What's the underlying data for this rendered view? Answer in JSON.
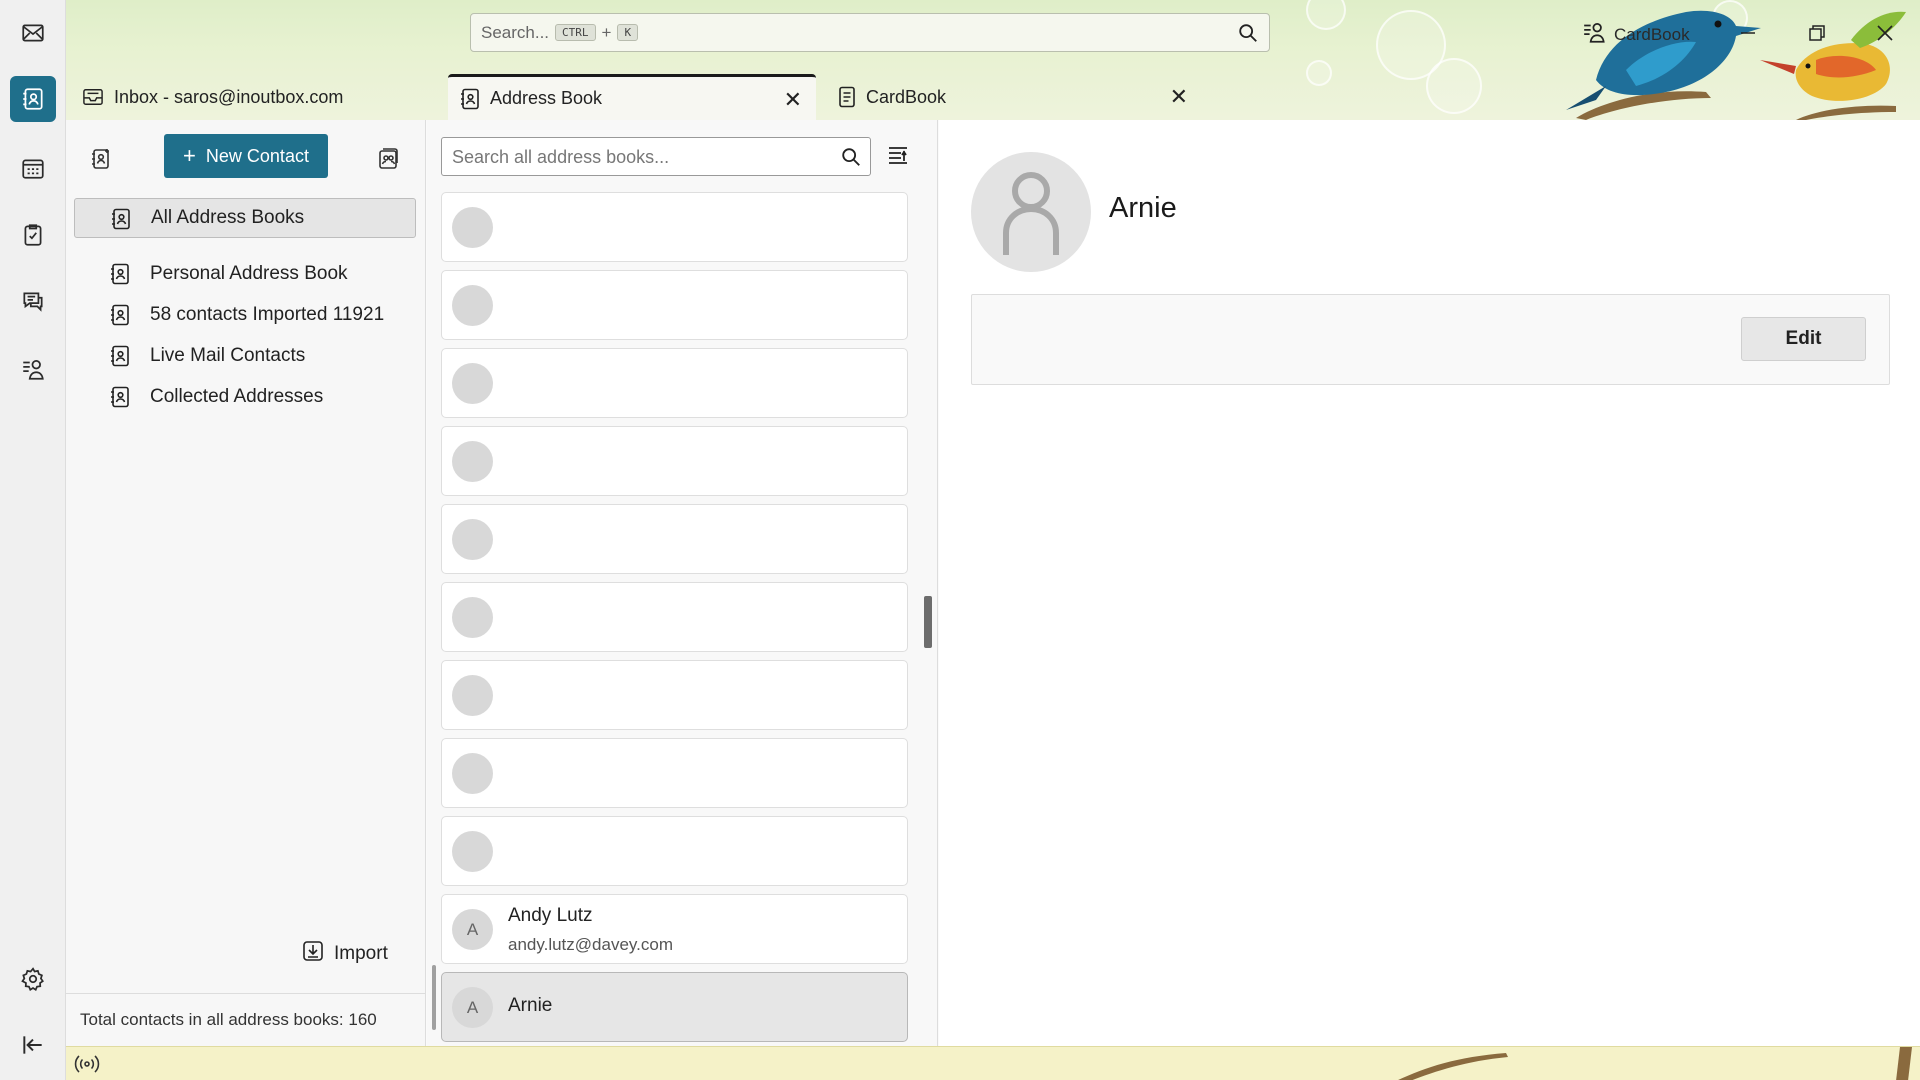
{
  "spaces": {
    "items": [
      {
        "name": "mail-icon"
      },
      {
        "name": "address-book-icon",
        "active": true
      },
      {
        "name": "calendar-icon"
      },
      {
        "name": "tasks-icon"
      },
      {
        "name": "chat-icon"
      },
      {
        "name": "cardbook-icon"
      }
    ],
    "bottom": [
      {
        "name": "settings-icon"
      },
      {
        "name": "collapse-icon"
      }
    ]
  },
  "titlebar": {
    "search_placeholder": "Search...",
    "shortcut_ctrl": "CTRL",
    "shortcut_plus": "+",
    "shortcut_key": "K",
    "cardbook_label": "CardBook"
  },
  "tabs": [
    {
      "label": "Inbox - saros@inoutbox.com",
      "icon": "inbox-icon"
    },
    {
      "label": "Address Book",
      "icon": "address-book-icon",
      "active": true,
      "close": "✕"
    },
    {
      "label": "CardBook",
      "icon": "cardbook-tab-icon",
      "close": "✕"
    }
  ],
  "left": {
    "new_contact": "New Contact",
    "new_contact_plus": "+",
    "books": [
      {
        "label": "All Address Books",
        "selected": true
      },
      {
        "label": "Personal Address Book"
      },
      {
        "label": "58 contacts Imported 11921"
      },
      {
        "label": "Live Mail Contacts"
      },
      {
        "label": "Collected Addresses"
      }
    ],
    "import": "Import",
    "total": "Total contacts in all address books: 160"
  },
  "middle": {
    "search_placeholder": "Search all address books...",
    "contacts": [
      {
        "name": "",
        "email": "",
        "initial": ""
      },
      {
        "name": "",
        "email": "",
        "initial": ""
      },
      {
        "name": "",
        "email": "",
        "initial": ""
      },
      {
        "name": "",
        "email": "",
        "initial": ""
      },
      {
        "name": "",
        "email": "",
        "initial": ""
      },
      {
        "name": "",
        "email": "",
        "initial": ""
      },
      {
        "name": "",
        "email": "",
        "initial": ""
      },
      {
        "name": "",
        "email": "",
        "initial": ""
      },
      {
        "name": "",
        "email": "",
        "initial": ""
      },
      {
        "name": "Andy Lutz",
        "email": "andy.lutz@davey.com",
        "initial": "A"
      },
      {
        "name": "Arnie",
        "email": "",
        "initial": "A",
        "selected": true
      }
    ]
  },
  "detail": {
    "name": "Arnie",
    "edit": "Edit"
  },
  "colors": {
    "accent": "#1f6f8b",
    "statusbar": "#f5f2c8"
  }
}
